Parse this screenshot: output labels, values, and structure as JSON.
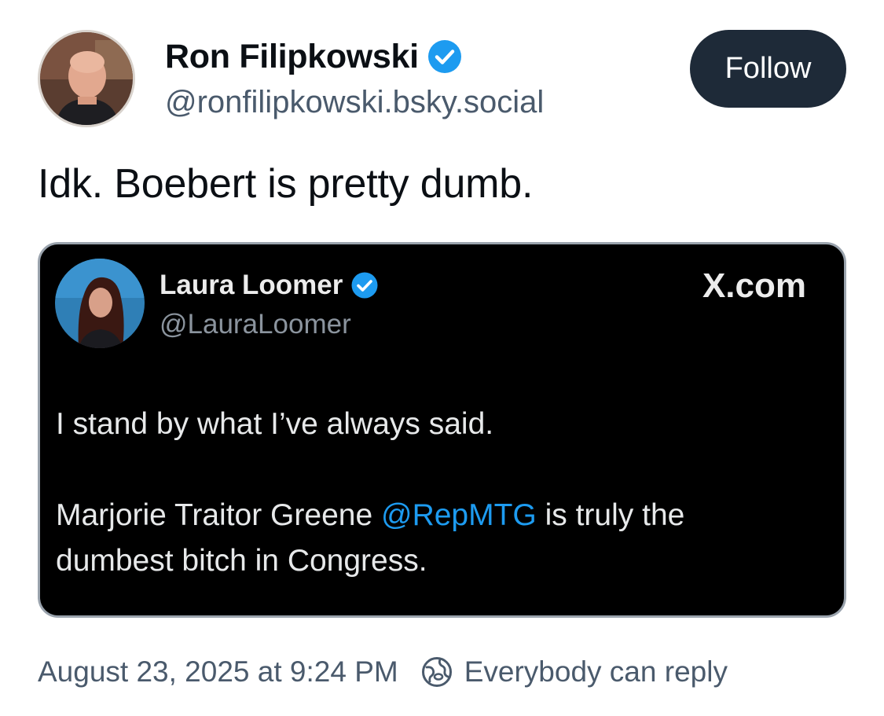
{
  "author": {
    "display_name": "Ron Filipkowski",
    "handle": "@ronfilipkowski.bsky.social",
    "verified": true
  },
  "follow_button": {
    "label": "Follow"
  },
  "post": {
    "text": "Idk. Boebert is pretty dumb."
  },
  "embed": {
    "author_name": "Laura Loomer",
    "author_handle": "@LauraLoomer",
    "verified": true,
    "source": "X.com",
    "line1": "I stand by what I’ve always said.",
    "line2_before": "Marjorie Traitor Greene ",
    "mention": "@RepMTG",
    "line2_after": " is truly the",
    "line3": "dumbest bitch in Congress."
  },
  "footer": {
    "timestamp": "August 23, 2025 at 9:24 PM",
    "reply_setting": "Everybody can reply",
    "reply_icon": "globe-reply-icon"
  },
  "colors": {
    "badge": "#1d9bf0",
    "follow_bg": "#1e2a38",
    "mention": "#1d9bf0",
    "embed_bg": "#000000",
    "muted_text": "#4a5a6c"
  }
}
